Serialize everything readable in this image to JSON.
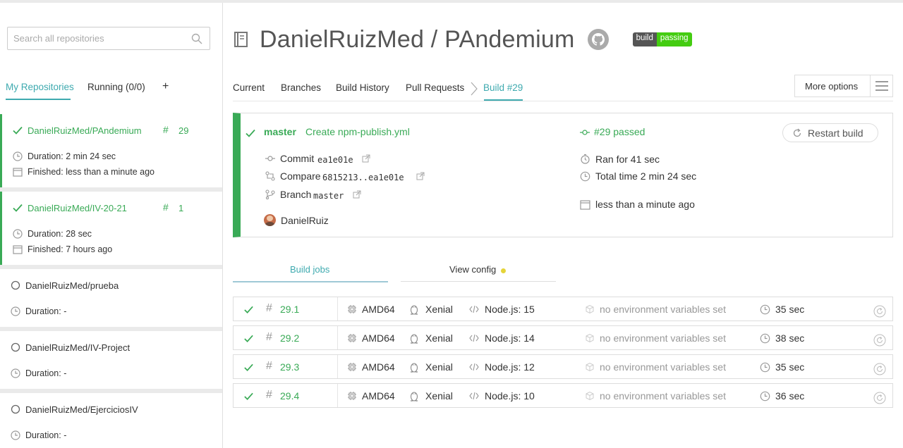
{
  "sidebar": {
    "search_placeholder": "Search all repositories",
    "tabs": [
      {
        "label": "My Repositories"
      },
      {
        "label": "Running (0/0)"
      },
      {
        "label": "+"
      }
    ],
    "repos": [
      {
        "name": "DanielRuizMed/PAndemium",
        "build_number": "29",
        "duration": "Duration: 2 min 24 sec",
        "finished": "Finished: less than a minute ago",
        "status": "passed"
      },
      {
        "name": "DanielRuizMed/IV-20-21",
        "build_number": "1",
        "duration": "Duration: 28 sec",
        "finished": "Finished: 7 hours ago",
        "status": "passed"
      },
      {
        "name": "DanielRuizMed/prueba",
        "duration": "Duration: -",
        "status": "none"
      },
      {
        "name": "DanielRuizMed/IV-Project",
        "duration": "Duration: -",
        "status": "none"
      },
      {
        "name": "DanielRuizMed/EjerciciosIV",
        "duration": "Duration: -",
        "status": "none"
      }
    ]
  },
  "header": {
    "title": "DanielRuizMed / PAndemium",
    "badge_left": "build",
    "badge_right": "passing"
  },
  "tabs": [
    {
      "label": "Current"
    },
    {
      "label": "Branches"
    },
    {
      "label": "Build History"
    },
    {
      "label": "Pull Requests"
    },
    {
      "label": "Build #29"
    }
  ],
  "more_options": "More options",
  "build": {
    "branch": "master",
    "message": "Create npm-publish.yml",
    "commit_label": "Commit",
    "commit_hash": "ea1e01e",
    "compare_label": "Compare",
    "compare_range": "6815213..ea1e01e",
    "branch_label": "Branch",
    "branch_name": "master",
    "author": "DanielRuiz",
    "status": "#29 passed",
    "ran_for": "Ran for 41 sec",
    "total_time": "Total time 2 min 24 sec",
    "finished": "less than a minute ago",
    "restart_label": "Restart build"
  },
  "job_tabs": [
    {
      "label": "Build jobs"
    },
    {
      "label": "View config"
    }
  ],
  "jobs": [
    {
      "number": "29.1",
      "arch": "AMD64",
      "os": "Xenial",
      "lang": "Node.js: 15",
      "env": "no environment variables set",
      "duration": "35 sec"
    },
    {
      "number": "29.2",
      "arch": "AMD64",
      "os": "Xenial",
      "lang": "Node.js: 14",
      "env": "no environment variables set",
      "duration": "38 sec"
    },
    {
      "number": "29.3",
      "arch": "AMD64",
      "os": "Xenial",
      "lang": "Node.js: 12",
      "env": "no environment variables set",
      "duration": "35 sec"
    },
    {
      "number": "29.4",
      "arch": "AMD64",
      "os": "Xenial",
      "lang": "Node.js: 10",
      "env": "no environment variables set",
      "duration": "36 sec"
    }
  ],
  "colors": {
    "accent": "#3eaaaf",
    "passed": "#39aa56",
    "badge_green": "#44cc11"
  }
}
